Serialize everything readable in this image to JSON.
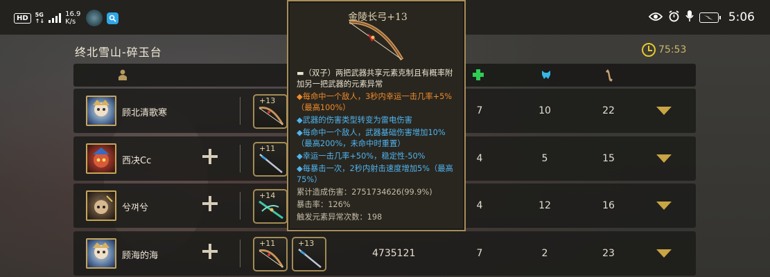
{
  "status_bar": {
    "hd": "HD",
    "net_top": "5G",
    "net_bottom": "↑↓",
    "speed_value": "16.9",
    "speed_unit": "K/s",
    "time": "5:06",
    "icons": [
      "eye-icon",
      "alarm-icon",
      "mic-icon",
      "battery-charging-icon"
    ]
  },
  "header": {
    "location": "终北雪山-碎玉台",
    "timer": "75:53"
  },
  "columns": {
    "icons": [
      "player-icon",
      "heal-icon",
      "kill-icon",
      "bone-icon"
    ],
    "colors": {
      "player": "#b89a5e",
      "heal": "#2ecc55",
      "kill": "#35b6e6",
      "bone": "#c8a070"
    }
  },
  "rows": [
    {
      "name": "顾北清歌寒",
      "show_plus": false,
      "weapons": [
        "+13"
      ],
      "damage": "",
      "stats": [
        "7",
        "10",
        "22"
      ]
    },
    {
      "name": "西决Cc",
      "show_plus": true,
      "weapons": [
        "+11"
      ],
      "damage": "",
      "stats": [
        "4",
        "5",
        "15"
      ]
    },
    {
      "name": "兮껴兮",
      "show_plus": true,
      "weapons": [
        "+14"
      ],
      "damage": "",
      "stats": [
        "4",
        "12",
        "16"
      ]
    },
    {
      "name": "顾海的海",
      "show_plus": true,
      "weapons": [
        "+11",
        "+13"
      ],
      "damage": "4735121",
      "stats": [
        "7",
        "2",
        "23"
      ]
    }
  ],
  "tooltip": {
    "title": "金陵长弓+13",
    "lines": [
      {
        "style": "desc",
        "text": "▬（双子）两把武器共享元素克制且有概率附加另一把武器的元素异常"
      },
      {
        "style": "orange",
        "text": "◆每命中一个敌人，3秒内幸运一击几率+5%（最高100%）"
      },
      {
        "style": "blue",
        "text": "◆武器的伤害类型转变为雷电伤害"
      },
      {
        "style": "blue",
        "text": "◆每命中一个敌人，武器基础伤害增加10%（最高200%，未命中时重置）"
      },
      {
        "style": "blue",
        "text": "◆幸运一击几率+50%，稳定性-50%"
      },
      {
        "style": "blue",
        "text": "◆每暴击一次，2秒内射击速度增加5%（最高75%）"
      },
      {
        "style": "stat",
        "text": "累计造成伤害：2751734626(99.9%)"
      },
      {
        "style": "stat",
        "text": "暴击率：126%"
      },
      {
        "style": "stat",
        "text": "触发元素异常次数：198"
      }
    ]
  },
  "colors": {
    "accent_gold": "#c9a544",
    "timer_yellow": "#e6c92a",
    "tooltip_orange": "#f08a2a",
    "tooltip_blue": "#4fb4f0"
  }
}
